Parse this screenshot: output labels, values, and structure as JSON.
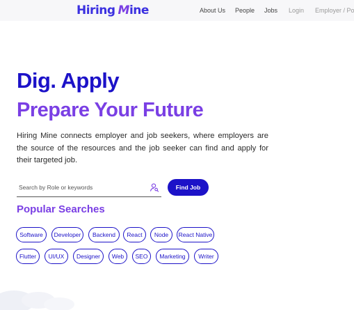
{
  "header": {
    "logo": {
      "word1": "Hiring",
      "word2_first": "M",
      "word2_rest": "ine"
    },
    "nav": {
      "about": "About Us",
      "people": "People",
      "jobs": "Jobs",
      "login": "Login",
      "employer": "Employer / Post"
    }
  },
  "hero": {
    "line1": "Dig. Apply",
    "line2": "Prepare Your Future",
    "description": "Hiring Mine connects employer and job seekers, where employers are the source of the resources and the job seeker can find and apply for their targeted job."
  },
  "search": {
    "placeholder": "Search by Role or keywords",
    "button": "Find Job"
  },
  "popular": {
    "title": "Popular Searches",
    "row1": [
      "Software",
      "Developer",
      "Backend",
      "React",
      "Node",
      "React Native"
    ],
    "row2": [
      "Flutter",
      "UI/UX",
      "Designer",
      "Web",
      "SEO",
      "Marketing",
      "Writer"
    ]
  },
  "colors": {
    "primary": "#1c12c8",
    "accent": "#7a3fe4"
  }
}
